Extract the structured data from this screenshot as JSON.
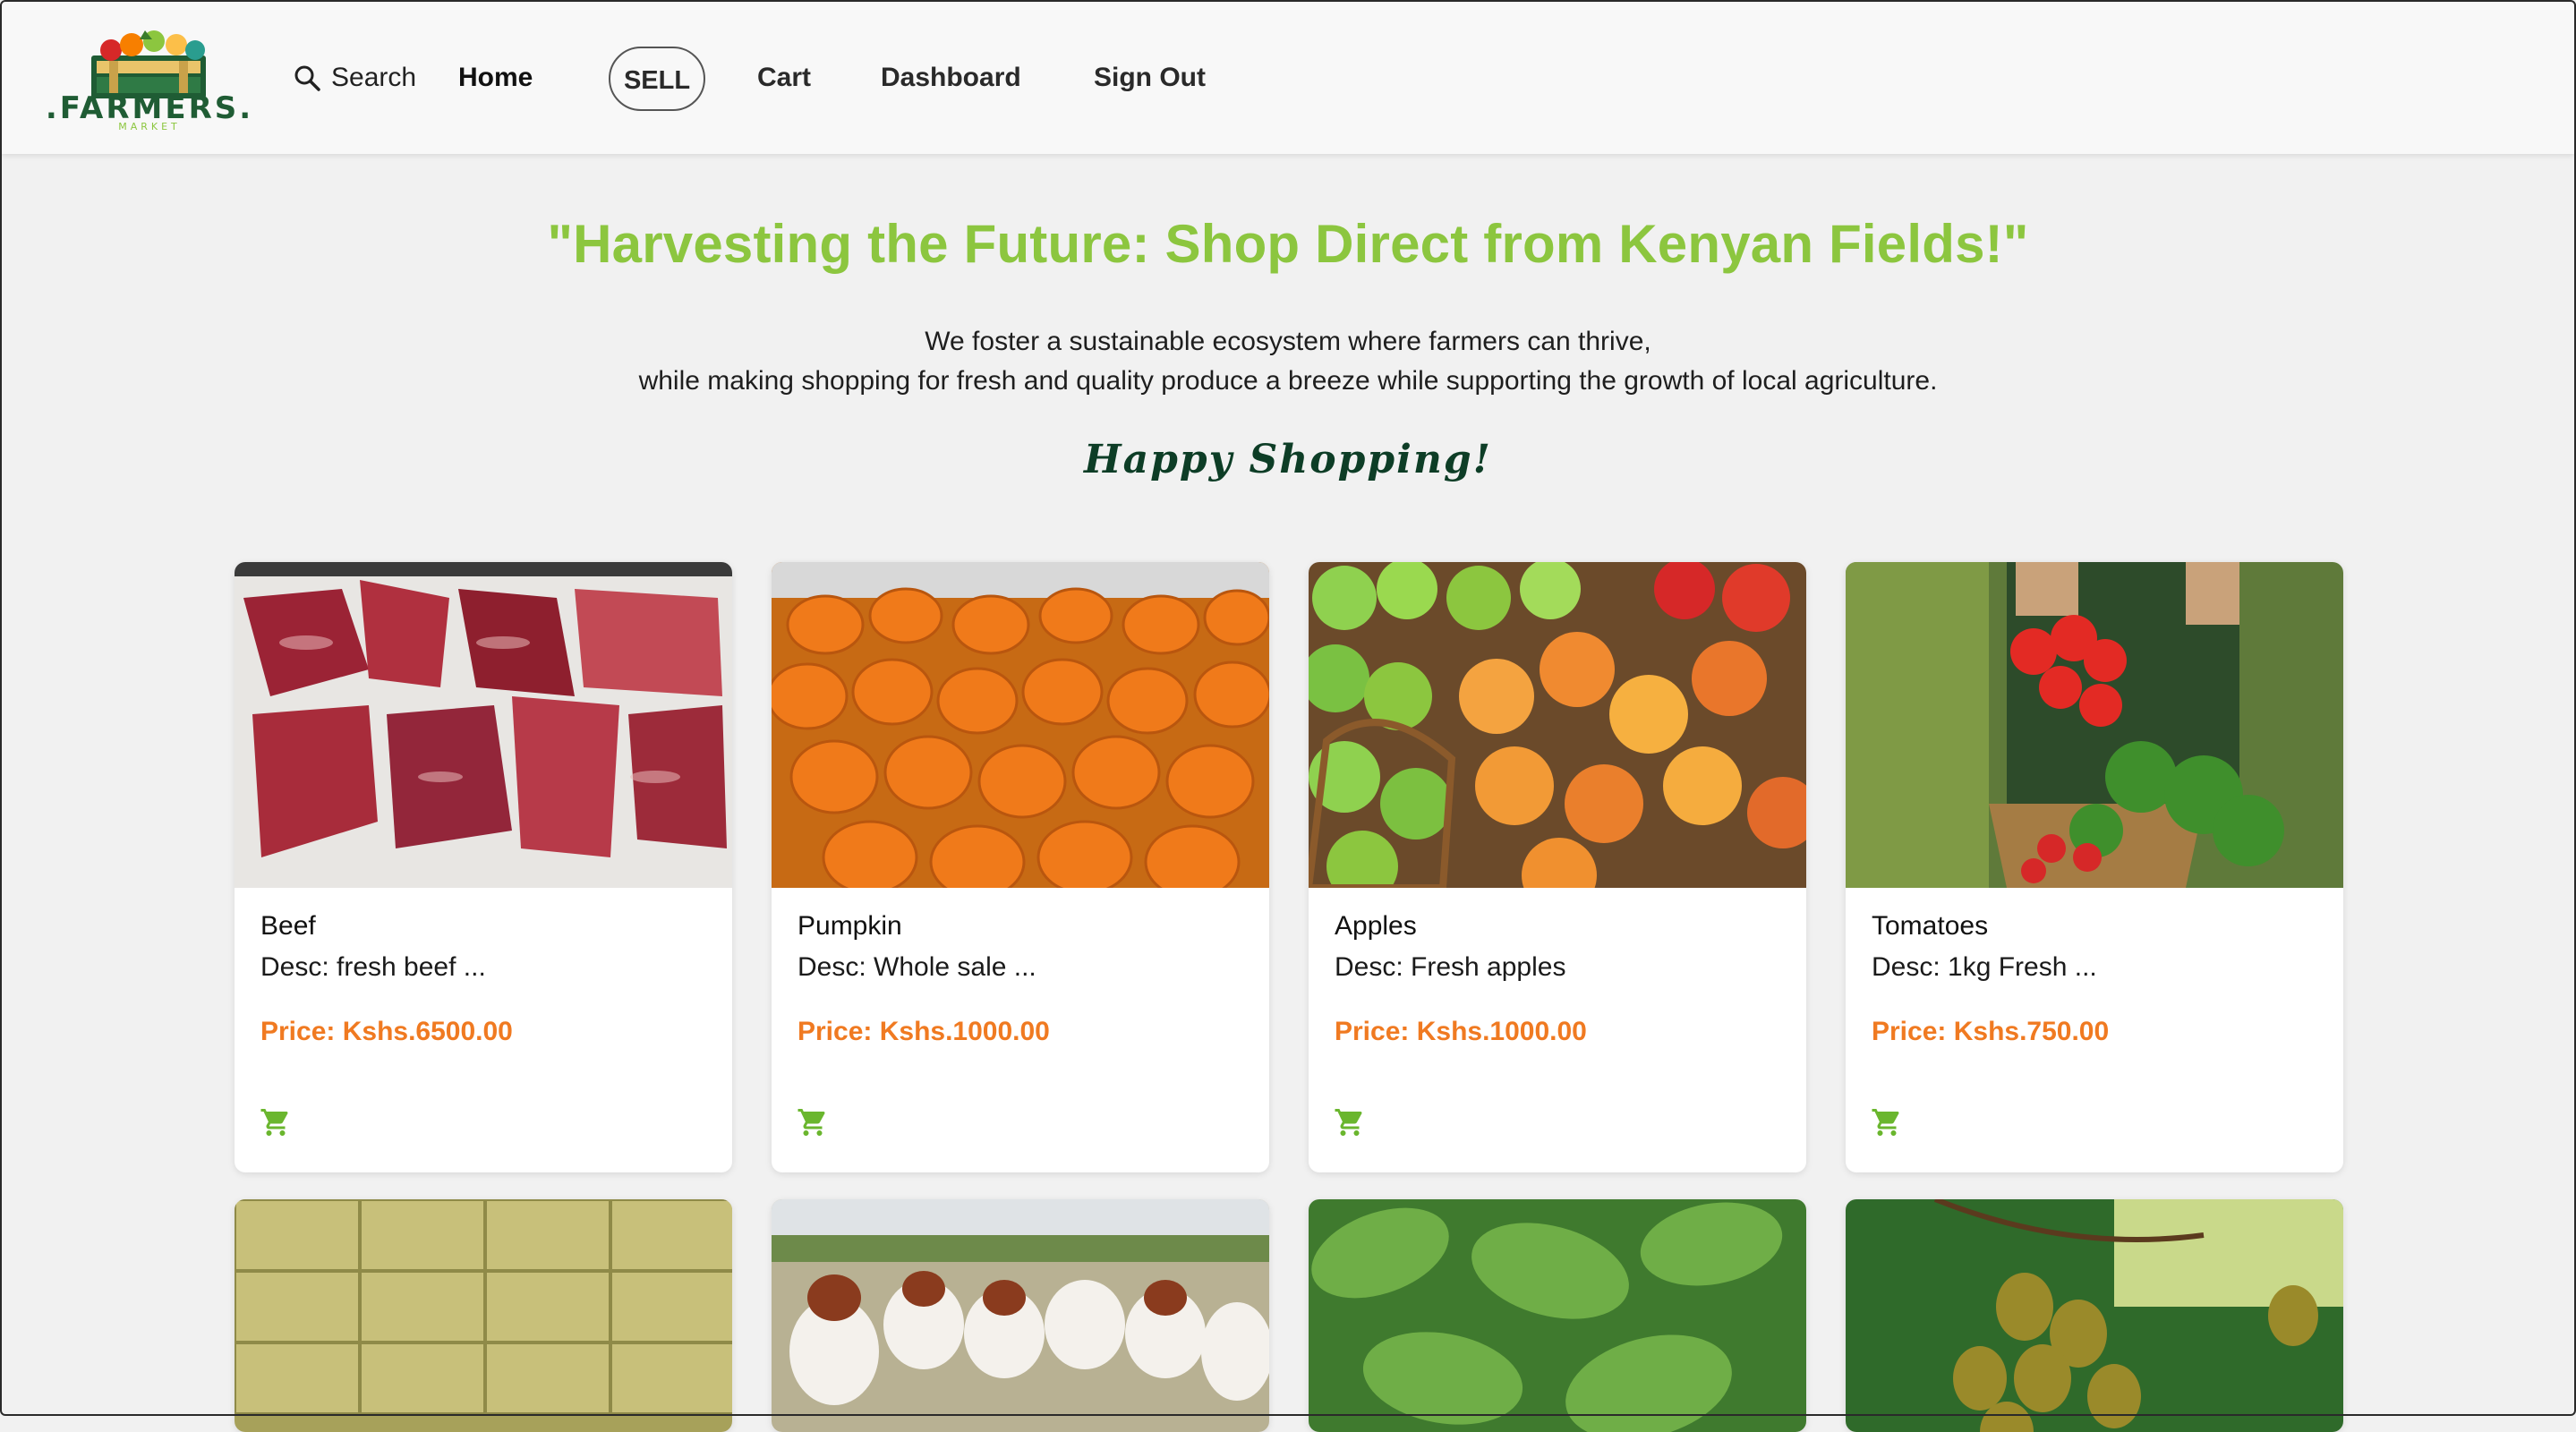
{
  "brand": {
    "logo_word": ".FARMERS.",
    "logo_sub": "MARKET"
  },
  "nav": {
    "search": "Search",
    "home": "Home",
    "sell": "SELL",
    "cart": "Cart",
    "dashboard": "Dashboard",
    "signout": "Sign Out"
  },
  "hero": {
    "title": "\"Harvesting the Future: Shop Direct from Kenyan Fields!\"",
    "line1": "We foster a sustainable ecosystem where farmers can thrive,",
    "line2": "while making shopping for fresh and quality produce a breeze while supporting the growth of local agriculture.",
    "happy": "Happy Shopping!"
  },
  "products": [
    {
      "name": "Beef",
      "desc": "Desc: fresh beef ...",
      "price": "Price: Kshs.6500.00",
      "image": "beef-photo"
    },
    {
      "name": "Pumpkin",
      "desc": "Desc: Whole sale ...",
      "price": "Price: Kshs.1000.00",
      "image": "pumpkin-photo"
    },
    {
      "name": "Apples",
      "desc": "Desc: Fresh apples",
      "price": "Price: Kshs.1000.00",
      "image": "apples-photo"
    },
    {
      "name": "Tomatoes",
      "desc": "Desc: 1kg Fresh ...",
      "price": "Price: Kshs.750.00",
      "image": "tomatoes-photo"
    }
  ],
  "products_row2": [
    {
      "image": "hay-photo"
    },
    {
      "image": "goats-photo"
    },
    {
      "image": "leaves-photo"
    },
    {
      "image": "kiwi-photo"
    }
  ],
  "colors": {
    "accent": "#8cc63f",
    "price": "#f07a21",
    "dark_green": "#0d3d26"
  },
  "icons": {
    "search": "search-icon",
    "cart": "cart-icon"
  }
}
